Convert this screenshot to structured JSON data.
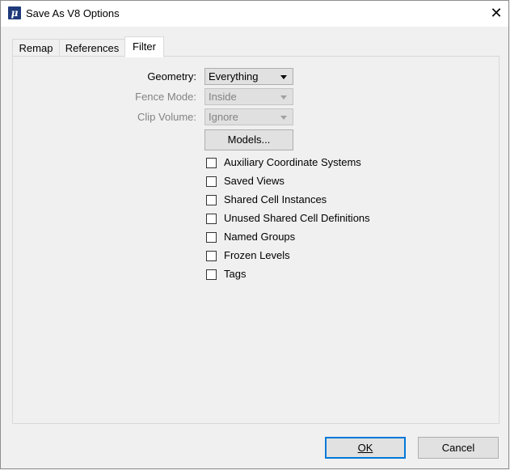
{
  "window": {
    "title": "Save As V8 Options",
    "app_icon_glyph": "μ",
    "close_glyph": "✕"
  },
  "tabs": [
    {
      "label": "Remap",
      "active": false
    },
    {
      "label": "References",
      "active": false
    },
    {
      "label": "Filter",
      "active": true
    }
  ],
  "filter": {
    "geometry": {
      "label": "Geometry:",
      "value": "Everything",
      "enabled": true
    },
    "fence_mode": {
      "label": "Fence Mode:",
      "value": "Inside",
      "enabled": false
    },
    "clip_volume": {
      "label": "Clip Volume:",
      "value": "Ignore",
      "enabled": false
    },
    "models_button": "Models...",
    "checkboxes": [
      {
        "label": "Auxiliary Coordinate Systems",
        "checked": false
      },
      {
        "label": "Saved Views",
        "checked": false
      },
      {
        "label": "Shared Cell Instances",
        "checked": false
      },
      {
        "label": "Unused Shared Cell Definitions",
        "checked": false
      },
      {
        "label": "Named Groups",
        "checked": false
      },
      {
        "label": "Frozen Levels",
        "checked": false
      },
      {
        "label": "Tags",
        "checked": false
      }
    ]
  },
  "buttons": {
    "ok": "OK",
    "cancel": "Cancel"
  },
  "colors": {
    "accent": "#0078d7",
    "disabled_text": "#838383"
  }
}
